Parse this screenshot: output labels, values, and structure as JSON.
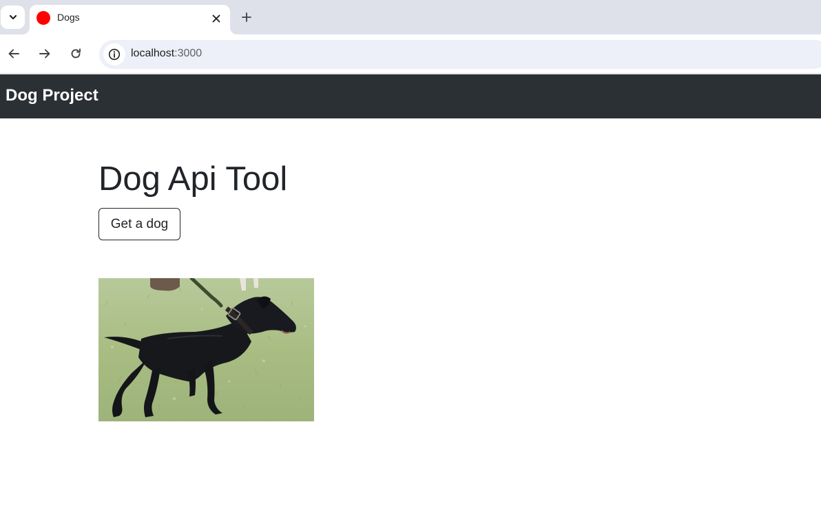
{
  "browser": {
    "tab": {
      "title": "Dogs",
      "favicon_color": "#ff0000"
    },
    "address_bar": {
      "host": "localhost",
      "port": ":3000"
    },
    "icons": [
      "chevron-down-icon",
      "close-icon",
      "plus-icon",
      "back-arrow-icon",
      "forward-arrow-icon",
      "reload-icon",
      "info-icon"
    ]
  },
  "navbar": {
    "brand": "Dog Project",
    "background": "#2b3035"
  },
  "main": {
    "heading": "Dog Api Tool",
    "button_label": "Get a dog",
    "image_subject": "black dog on a leash standing on grass"
  }
}
